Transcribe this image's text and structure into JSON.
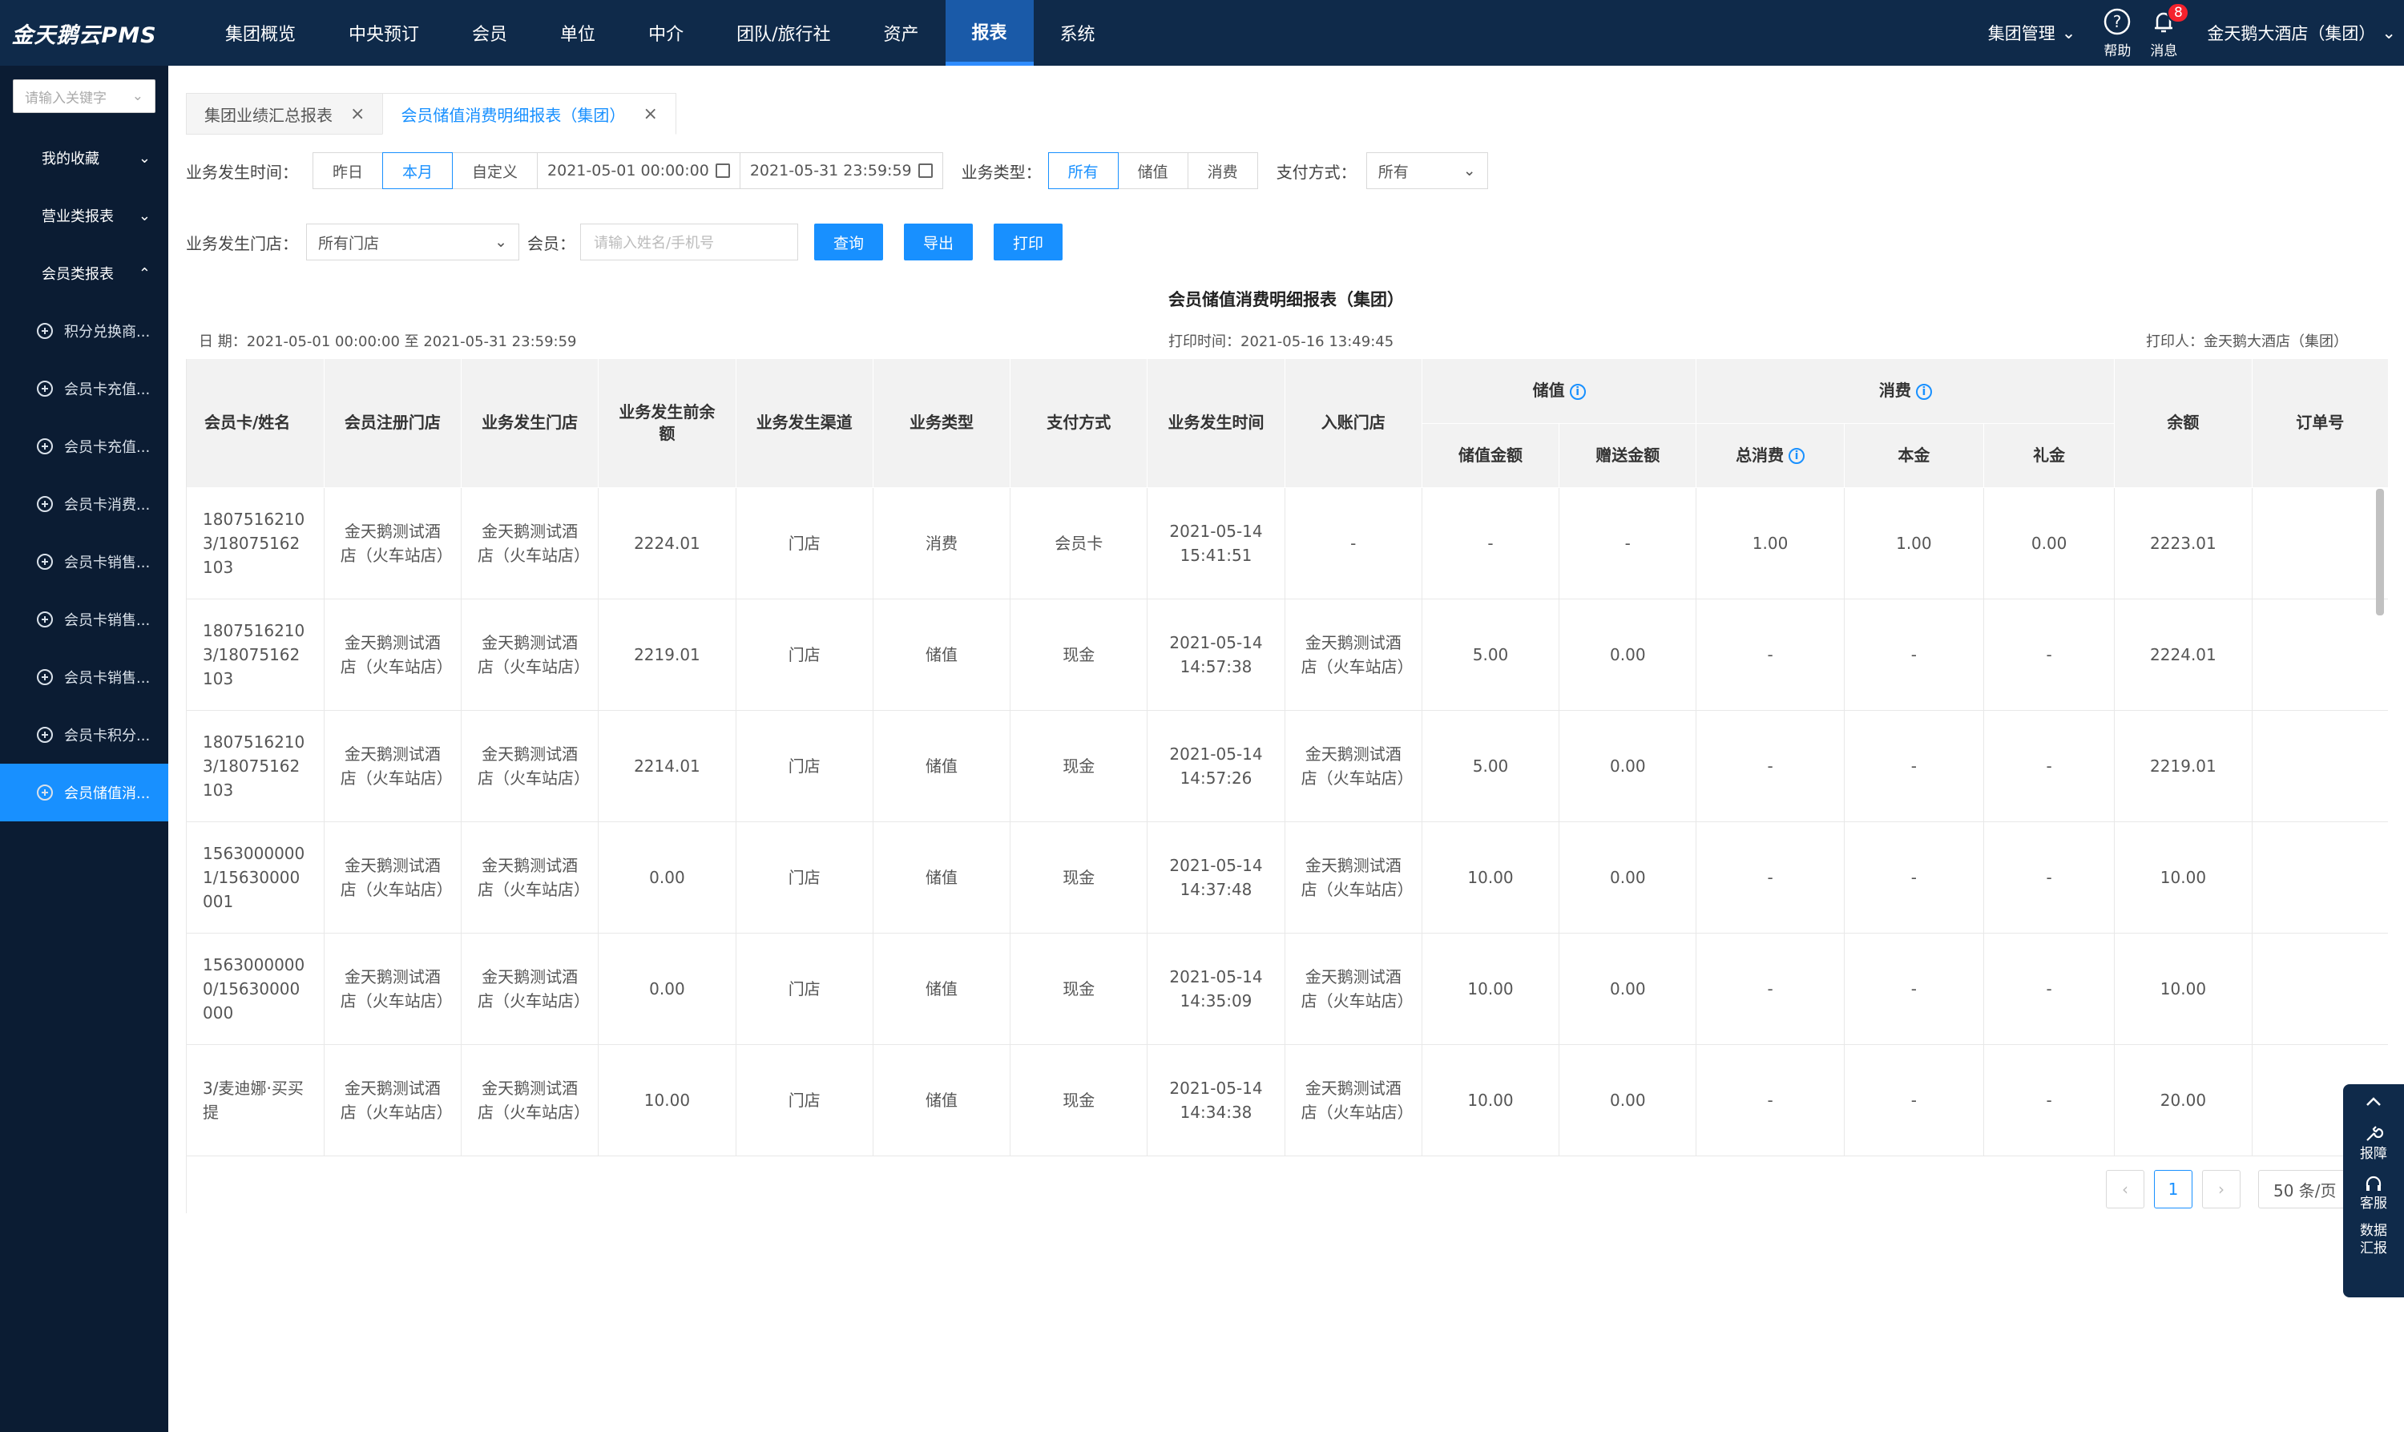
{
  "app": {
    "logo": "金天鹅云PMS"
  },
  "nav": [
    "集团概览",
    "中央预订",
    "会员",
    "单位",
    "中介",
    "团队/旅行社",
    "资产",
    "报表",
    "系统"
  ],
  "nav_active": 7,
  "top_right": {
    "group_mgmt": "集团管理",
    "help": "帮助",
    "messages": "消息",
    "msg_count": "8",
    "hotel": "金天鹅大酒店（集团）"
  },
  "sidebar": {
    "search_placeholder": "请输入关键字",
    "groups": [
      "我的收藏",
      "营业类报表",
      "会员类报表"
    ],
    "items": [
      "积分兑换商...",
      "会员卡充值...",
      "会员卡充值...",
      "会员卡消费...",
      "会员卡销售...",
      "会员卡销售...",
      "会员卡销售...",
      "会员卡积分...",
      "会员储值消..."
    ],
    "active_item": 8
  },
  "tabs": [
    {
      "label": "集团业绩汇总报表",
      "active": false
    },
    {
      "label": "会员储值消费明细报表（集团）",
      "active": true
    }
  ],
  "filters": {
    "time_label": "业务发生时间：",
    "time_options": [
      "昨日",
      "本月",
      "自定义"
    ],
    "time_active": 1,
    "date_start": "2021-05-01 00:00:00",
    "date_end": "2021-05-31 23:59:59",
    "type_label": "业务类型：",
    "type_options": [
      "所有",
      "储值",
      "消费"
    ],
    "type_active": 0,
    "pay_label": "支付方式：",
    "pay_value": "所有",
    "store_label": "业务发生门店：",
    "store_value": "所有门店",
    "member_label": "会员：",
    "member_placeholder": "请输入姓名/手机号",
    "btn_query": "查询",
    "btn_export": "导出",
    "btn_print": "打印"
  },
  "report": {
    "title": "会员储值消费明细报表（集团）",
    "date_range": "日 期：2021-05-01 00:00:00 至 2021-05-31 23:59:59",
    "print_time": "打印时间：2021-05-16 13:49:45",
    "printer": "打印人：金天鹅大酒店（集团）"
  },
  "table": {
    "headers": {
      "card": "会员卡/姓名",
      "reg_store": "会员注册门店",
      "biz_store": "业务发生门店",
      "pre_balance": "业务发生前余额",
      "channel": "业务发生渠道",
      "biz_type": "业务类型",
      "pay": "支付方式",
      "time": "业务发生时间",
      "acc_store": "入账门店",
      "stored": "储值",
      "stored_amt": "储值金额",
      "bonus_amt": "赠送金额",
      "consume": "消费",
      "total_consume": "总消费",
      "principal": "本金",
      "gift": "礼金",
      "balance": "余额",
      "order_no": "订单号"
    },
    "rows": [
      {
        "card": "18075162103/18075162103",
        "reg": "金天鹅测试酒店（火车站店）",
        "biz": "金天鹅测试酒店（火车站店）",
        "pre": "2224.01",
        "channel": "门店",
        "type": "消费",
        "pay": "会员卡",
        "time": "2021-05-14 15:41:51",
        "acc": "-",
        "stored": "-",
        "bonus": "-",
        "total": "1.00",
        "principal": "1.00",
        "gift": "0.00",
        "balance": "2223.01",
        "order": ""
      },
      {
        "card": "18075162103/18075162103",
        "reg": "金天鹅测试酒店（火车站店）",
        "biz": "金天鹅测试酒店（火车站店）",
        "pre": "2219.01",
        "channel": "门店",
        "type": "储值",
        "pay": "现金",
        "time": "2021-05-14 14:57:38",
        "acc": "金天鹅测试酒店（火车站店）",
        "stored": "5.00",
        "bonus": "0.00",
        "total": "-",
        "principal": "-",
        "gift": "-",
        "balance": "2224.01",
        "order": ""
      },
      {
        "card": "18075162103/18075162103",
        "reg": "金天鹅测试酒店（火车站店）",
        "biz": "金天鹅测试酒店（火车站店）",
        "pre": "2214.01",
        "channel": "门店",
        "type": "储值",
        "pay": "现金",
        "time": "2021-05-14 14:57:26",
        "acc": "金天鹅测试酒店（火车站店）",
        "stored": "5.00",
        "bonus": "0.00",
        "total": "-",
        "principal": "-",
        "gift": "-",
        "balance": "2219.01",
        "order": ""
      },
      {
        "card": "15630000001/15630000001",
        "reg": "金天鹅测试酒店（火车站店）",
        "biz": "金天鹅测试酒店（火车站店）",
        "pre": "0.00",
        "channel": "门店",
        "type": "储值",
        "pay": "现金",
        "time": "2021-05-14 14:37:48",
        "acc": "金天鹅测试酒店（火车站店）",
        "stored": "10.00",
        "bonus": "0.00",
        "total": "-",
        "principal": "-",
        "gift": "-",
        "balance": "10.00",
        "order": ""
      },
      {
        "card": "15630000000/15630000000",
        "reg": "金天鹅测试酒店（火车站店）",
        "biz": "金天鹅测试酒店（火车站店）",
        "pre": "0.00",
        "channel": "门店",
        "type": "储值",
        "pay": "现金",
        "time": "2021-05-14 14:35:09",
        "acc": "金天鹅测试酒店（火车站店）",
        "stored": "10.00",
        "bonus": "0.00",
        "total": "-",
        "principal": "-",
        "gift": "-",
        "balance": "10.00",
        "order": ""
      },
      {
        "card": "3/麦迪娜·买买提",
        "reg": "金天鹅测试酒店（火车站店）",
        "biz": "金天鹅测试酒店（火车站店）",
        "pre": "10.00",
        "channel": "门店",
        "type": "储值",
        "pay": "现金",
        "time": "2021-05-14 14:34:38",
        "acc": "金天鹅测试酒店（火车站店）",
        "stored": "10.00",
        "bonus": "0.00",
        "total": "-",
        "principal": "-",
        "gift": "-",
        "balance": "20.00",
        "order": ""
      }
    ]
  },
  "pager": {
    "page": "1",
    "page_size": "50 条/页"
  },
  "float": {
    "report": "报障",
    "service": "客服",
    "data": "数据汇报"
  }
}
